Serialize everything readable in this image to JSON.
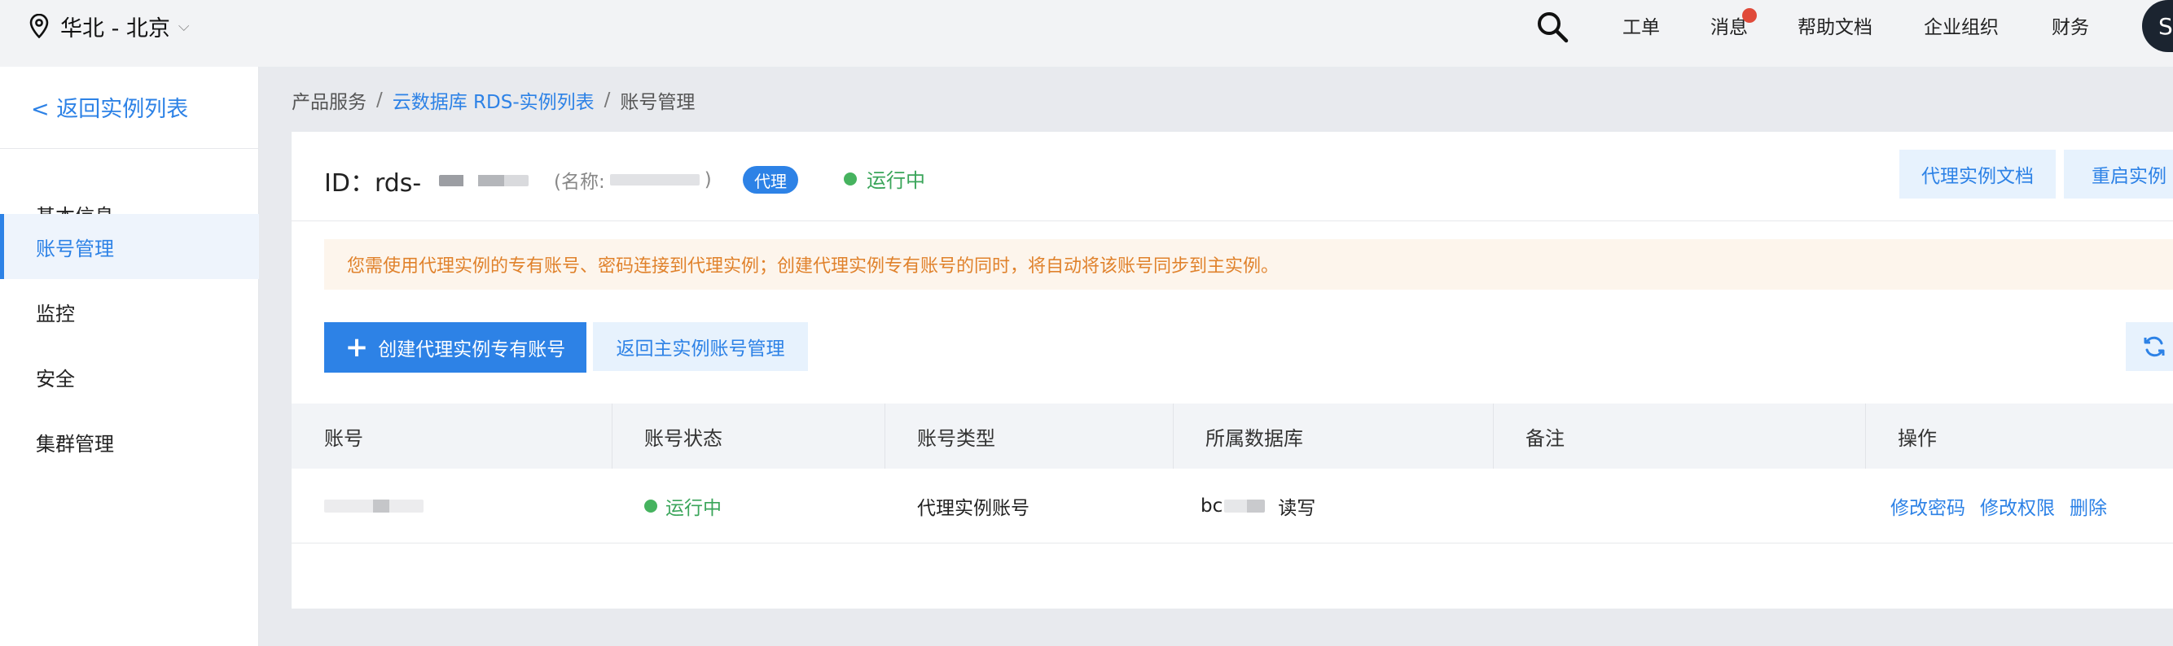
{
  "header": {
    "region": "华北 - 北京",
    "nav": {
      "ticket": "工单",
      "messages": "消息",
      "help": "帮助文档",
      "org": "企业组织",
      "finance": "财务"
    },
    "avatar_initial": "S"
  },
  "sidebar": {
    "back_label": "< 返回实例列表",
    "items": [
      "基本信息",
      "账号管理",
      "监控",
      "安全",
      "集群管理"
    ],
    "active_index": 1
  },
  "breadcrumb": {
    "root": "产品服务",
    "sep": "/",
    "middle": "云数据库 RDS-实例列表",
    "current": "账号管理"
  },
  "instance": {
    "id_prefix": "ID：rds-",
    "name_prefix": "(名称:",
    "name_suffix": ")",
    "badge": "代理",
    "status": "运行中"
  },
  "actions": {
    "doc_button": "代理实例文档",
    "restart_button": "重启实例"
  },
  "notice": "您需使用代理实例的专有账号、密码连接到代理实例；创建代理实例专有账号的同时，将自动将该账号同步到主实例。",
  "toolbar": {
    "create_button": "创建代理实例专有账号",
    "return_button": "返回主实例账号管理"
  },
  "table": {
    "headers": [
      "账号",
      "账号状态",
      "账号类型",
      "所属数据库",
      "备注",
      "操作"
    ],
    "rows": [
      {
        "status": "运行中",
        "type": "代理实例账号",
        "db_prefix": "bc",
        "db_perm": "读写",
        "remark": "",
        "actions": [
          "修改密码",
          "修改权限",
          "删除"
        ]
      }
    ]
  },
  "colors": {
    "accent": "#2d82e6",
    "running": "#46b35f",
    "notice_text": "#e0822c",
    "notice_bg": "#fdf5ec",
    "badge_dot": "#e04a3a"
  }
}
